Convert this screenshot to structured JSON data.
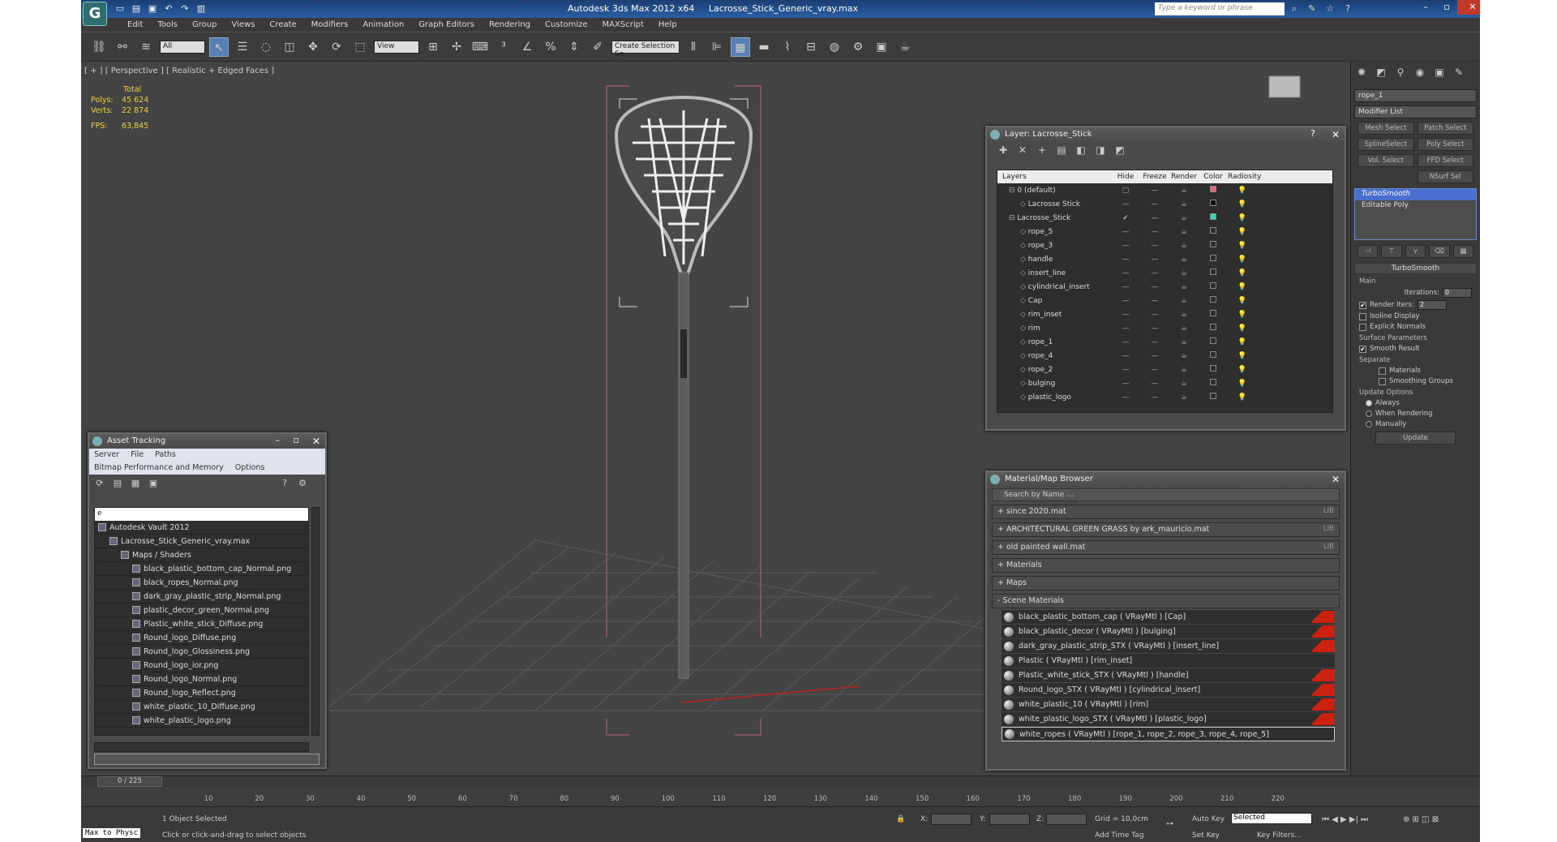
{
  "titlebar": {
    "app_title": "Autodesk 3ds Max  2012 x64",
    "file_name": "Lacrosse_Stick_Generic_vray.max",
    "search_placeholder": "Type a keyword or phrase"
  },
  "menu": [
    "Edit",
    "Tools",
    "Group",
    "Views",
    "Create",
    "Modifiers",
    "Animation",
    "Graph Editors",
    "Rendering",
    "Customize",
    "MAXScript",
    "Help"
  ],
  "toolbar": {
    "selection_filter": "All",
    "ref_coord": "View",
    "named_selection": "Create Selection Se"
  },
  "viewport": {
    "label": "[ + ] [ Perspective ] [ Realistic + Edged Faces ]",
    "stats": {
      "total_label": "Total",
      "polys_label": "Polys:",
      "polys_value": "45 624",
      "verts_label": "Verts:",
      "verts_value": "22 874",
      "fps_label": "FPS:",
      "fps_value": "63,845"
    }
  },
  "command_panel": {
    "object_name": "rope_1",
    "modifier_list": "Modifier List",
    "buttons": [
      [
        "Mesh Select",
        "Patch Select"
      ],
      [
        "SplineSelect",
        "Poly Select"
      ],
      [
        "Vol. Select",
        "FFD Select"
      ],
      [
        "",
        "NSurf Sel"
      ]
    ],
    "stack": [
      "TurboSmooth",
      "Editable Poly"
    ],
    "turbosmooth": {
      "title": "TurboSmooth",
      "main": "Main",
      "iterations_label": "Iterations:",
      "iterations_value": "0",
      "render_iters_label": "Render Iters:",
      "render_iters_value": "2",
      "isoline": "Isoline Display",
      "explicit": "Explicit Normals",
      "surface_params": "Surface Parameters",
      "smooth_result": "Smooth Result",
      "separate": "Separate",
      "materials": "Materials",
      "smoothing_groups": "Smoothing Groups",
      "update_options": "Update Options",
      "always": "Always",
      "when_rendering": "When Rendering",
      "manually": "Manually",
      "update_button": "Update"
    }
  },
  "layer_window": {
    "title": "Layer: Lacrosse_Stick",
    "columns": [
      "Layers",
      "Hide",
      "Freeze",
      "Render",
      "Color",
      "Radiosity"
    ],
    "rows": [
      {
        "name": "0 (default)",
        "indent": 1,
        "color": "#e0647a"
      },
      {
        "name": "Lacrosse Stick",
        "indent": 2,
        "color": "#111111"
      },
      {
        "name": "Lacrosse_Stick",
        "indent": 1,
        "color": "#38d9b0"
      },
      {
        "name": "rope_5",
        "indent": 2,
        "color": ""
      },
      {
        "name": "rope_3",
        "indent": 2,
        "color": ""
      },
      {
        "name": "handle",
        "indent": 2,
        "color": ""
      },
      {
        "name": "insert_line",
        "indent": 2,
        "color": ""
      },
      {
        "name": "cylindrical_insert",
        "indent": 2,
        "color": ""
      },
      {
        "name": "Cap",
        "indent": 2,
        "color": ""
      },
      {
        "name": "rim_inset",
        "indent": 2,
        "color": ""
      },
      {
        "name": "rim",
        "indent": 2,
        "color": ""
      },
      {
        "name": "rope_1",
        "indent": 2,
        "color": ""
      },
      {
        "name": "rope_4",
        "indent": 2,
        "color": ""
      },
      {
        "name": "rope_2",
        "indent": 2,
        "color": ""
      },
      {
        "name": "bulging",
        "indent": 2,
        "color": ""
      },
      {
        "name": "plastic_logo",
        "indent": 2,
        "color": ""
      }
    ]
  },
  "asset_window": {
    "title": "Asset Tracking",
    "menu1": [
      "Server",
      "File",
      "Paths"
    ],
    "menu2": [
      "Bitmap Performance and Memory",
      "Options"
    ],
    "filter_value": "e",
    "items": [
      {
        "name": "Autodesk Vault 2012",
        "indent": 0
      },
      {
        "name": "Lacrosse_Stick_Generic_vray.max",
        "indent": 1
      },
      {
        "name": "Maps / Shaders",
        "indent": 2
      },
      {
        "name": "black_plastic_bottom_cap_Normal.png",
        "indent": 3
      },
      {
        "name": "black_ropes_Normal.png",
        "indent": 3
      },
      {
        "name": "dark_gray_plastic_strip_Normal.png",
        "indent": 3
      },
      {
        "name": "plastic_decor_green_Normal.png",
        "indent": 3
      },
      {
        "name": "Plastic_white_stick_Diffuse.png",
        "indent": 3
      },
      {
        "name": "Round_logo_Diffuse.png",
        "indent": 3
      },
      {
        "name": "Round_logo_Glossiness.png",
        "indent": 3
      },
      {
        "name": "Round_logo_ior.png",
        "indent": 3
      },
      {
        "name": "Round_logo_Normal.png",
        "indent": 3
      },
      {
        "name": "Round_logo_Reflect.png",
        "indent": 3
      },
      {
        "name": "white_plastic_10_Diffuse.png",
        "indent": 3
      },
      {
        "name": "white_plastic_logo.png",
        "indent": 3
      }
    ]
  },
  "material_window": {
    "title": "Material/Map Browser",
    "search": "Search by Name ...",
    "groups": [
      {
        "label": "+ since 2020.mat",
        "lib": "LIB"
      },
      {
        "label": "+ ARCHITECTURAL GREEN GRASS by ark_mauricio.mat",
        "lib": "LIB"
      },
      {
        "label": "+ old painted wall.mat",
        "lib": "LIB"
      },
      {
        "label": "+ Materials",
        "lib": ""
      },
      {
        "label": "+ Maps",
        "lib": ""
      },
      {
        "label": "- Scene Materials",
        "lib": ""
      }
    ],
    "scene_materials": [
      {
        "name": "black_plastic_bottom_cap  ( VRayMtl ) [Cap]",
        "flag": true
      },
      {
        "name": "black_plastic_decor  ( VRayMtl ) [bulging]",
        "flag": true
      },
      {
        "name": "dark_gray_plastic_strip_STX  ( VRayMtl ) [insert_line]",
        "flag": true
      },
      {
        "name": "Plastic  ( VRayMtl ) [rim_inset]",
        "flag": false
      },
      {
        "name": "Plastic_white_stick_STX  ( VRayMtl ) [handle]",
        "flag": true
      },
      {
        "name": "Round_logo_STX  ( VRayMtl ) [cylindrical_insert]",
        "flag": true
      },
      {
        "name": "white_plastic_10  ( VRayMtl ) [rim]",
        "flag": true
      },
      {
        "name": "white_plastic_logo_STX  ( VRayMtl ) [plastic_logo]",
        "flag": true
      },
      {
        "name": "white_ropes  ( VRayMtl ) [rope_1, rope_2, rope_3, rope_4, rope_5]",
        "flag": false
      }
    ]
  },
  "timeline": {
    "frame": "0 / 225",
    "ticks": [
      "10",
      "20",
      "30",
      "40",
      "50",
      "60",
      "70",
      "80",
      "90",
      "100",
      "110",
      "120",
      "130",
      "140",
      "150",
      "160",
      "170",
      "180",
      "190",
      "200",
      "210",
      "220"
    ]
  },
  "status": {
    "maxscript": "Max to Physc",
    "selected": "1 Object Selected",
    "hint": "Click or click-and-drag to select objects",
    "x_label": "X:",
    "y_label": "Y:",
    "z_label": "Z:",
    "grid": "Grid = 10,0cm",
    "add_time_tag": "Add Time Tag",
    "auto_key": "Auto Key",
    "set_key": "Set Key",
    "key_mode": "Selected",
    "key_filters": "Key Filters..."
  }
}
